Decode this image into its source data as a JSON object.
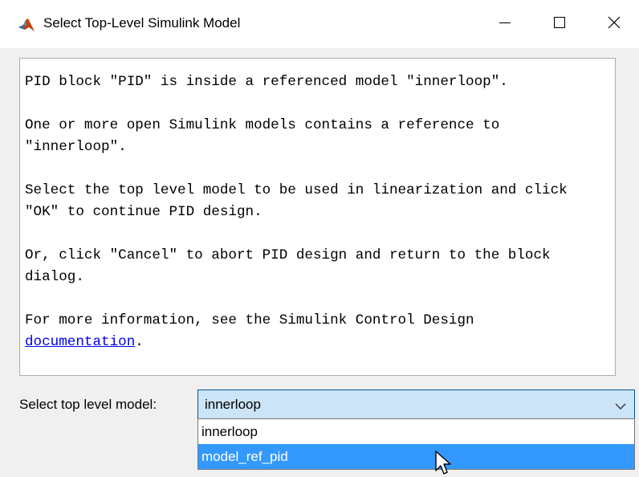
{
  "window": {
    "title": "Select Top-Level Simulink Model",
    "icon": "matlab-icon",
    "controls": {
      "minimize_icon": "minimize-icon",
      "maximize_icon": "maximize-icon",
      "close_icon": "close-icon"
    }
  },
  "message": {
    "lines": [
      "PID block \"PID\" is inside a referenced model \"innerloop\".",
      "",
      "One or more open Simulink models contains a reference to",
      "\"innerloop\".",
      "",
      "Select the top level model to be used in linearization and click",
      "\"OK\" to continue PID design.",
      "",
      "Or, click \"Cancel\" to abort PID design and return to the block",
      "dialog.",
      "",
      "For more information, see the Simulink Control Design"
    ],
    "link_text": "documentation",
    "link_suffix": "."
  },
  "model_select": {
    "label": "Select top level model:",
    "selected_value": "innerloop",
    "arrow_icon": "chevron-down-icon",
    "options": [
      "innerloop",
      "model_ref_pid"
    ],
    "highlighted_option": "model_ref_pid"
  },
  "colors": {
    "highlight": "#3399ff",
    "combo_background": "#cce4f7",
    "link": "#0000ee"
  }
}
